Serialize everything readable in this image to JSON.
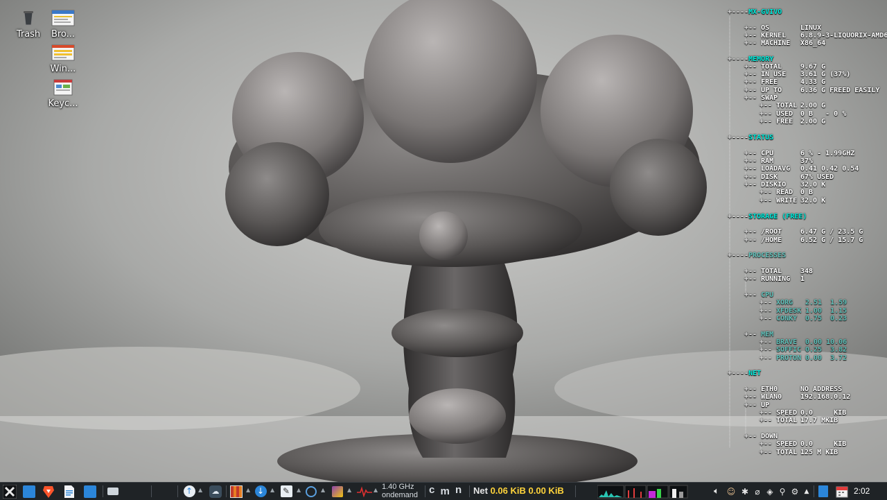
{
  "desktop": {
    "icons": [
      {
        "label": "Trash",
        "icon": "trash-icon"
      },
      {
        "label": "Bro...",
        "icon": "document-thumbnail-icon"
      },
      {
        "label": "Win...",
        "icon": "document-thumbnail-icon"
      },
      {
        "label": "Keyc...",
        "icon": "document-thumbnail-icon"
      }
    ]
  },
  "conky": {
    "host": "MX-GVIVO",
    "system": {
      "os_label": "OS",
      "os": "LINUX",
      "kernel_label": "KERNEL",
      "kernel": "6.8.9-3-LIQUORIX-AMD6",
      "machine_label": "MACHINE",
      "machine": "X86_64"
    },
    "memory": {
      "title": "MEMORY",
      "total_label": "TOTAL",
      "total": "9.67 G",
      "inuse_label": "IN USE",
      "inuse": "3.61 G (37%)",
      "free_label": "FREE",
      "free": "4.33 G",
      "upto_label": "UP TO",
      "upto": "6.36 G FREED EASILY",
      "swap_label": "SWAP",
      "swap_total_label": "TOTAL",
      "swap_total": "2.00 G",
      "swap_used_label": "USED",
      "swap_used": "0 B   - 0 %",
      "swap_free_label": "FREE",
      "swap_free": "2.00 G"
    },
    "status": {
      "title": "STATUS",
      "cpu_label": "CPU",
      "cpu": "6 % - 1.99GHZ",
      "ram_label": "RAM",
      "ram": "37%",
      "loadavg_label": "LOADAVG",
      "loadavg": "0.41 0.42 0.54",
      "disk_label": "DISK",
      "disk": "67% USED",
      "diskio_label": "DISKIO",
      "diskio": "32.0 K",
      "read_label": "READ",
      "read": "0 B",
      "write_label": "WRITE",
      "write": "32.0 K"
    },
    "storage": {
      "title": "STORAGE (FREE)",
      "root_label": "/ROOT",
      "root": "6.47 G / 23.5 G",
      "home_label": "/HOME",
      "home": "6.52 G / 15.7 G"
    },
    "processes": {
      "title": "PROCESSES",
      "total_label": "TOTAL",
      "total": "348",
      "running_label": "RUNNING",
      "running": "1",
      "cpu_label": "CPU",
      "cpu_rows": [
        {
          "name": "XORG",
          "vals": "2.51  1.59"
        },
        {
          "name": "XFDESK",
          "vals": "1.00  1.15"
        },
        {
          "name": "CONKY",
          "vals": "0.75  0.23"
        }
      ],
      "mem_label": "MEM",
      "mem_rows": [
        {
          "name": "BRAVE",
          "vals": "0.00 10.06"
        },
        {
          "name": "SOFFIC",
          "vals": "0.25  3.82"
        },
        {
          "name": "PROTON",
          "vals": "0.00  3.72"
        }
      ]
    },
    "net": {
      "title": "NET",
      "eth0_label": "ETH0",
      "eth0": "NO ADDRESS",
      "wlan0_label": "WLAN0",
      "wlan0": "192.168.0.12",
      "up_label": "UP",
      "up_speed_label": "SPEED",
      "up_speed": "0.0     KIB",
      "up_total_label": "TOTAL",
      "up_total": "17.7 MKIB",
      "down_label": "DOWN",
      "down_speed_label": "SPEED",
      "down_speed": "0.0     KIB",
      "down_total_label": "TOTAL",
      "down_total": "125 M KIB"
    }
  },
  "taskbar": {
    "cpufreq_line1": "1.40 GHz",
    "cpufreq_line2": "ondemand",
    "mon_c": "c",
    "mon_m": "m",
    "mon_n": "n",
    "net_label": "Net",
    "net_down": "0.06 KiB",
    "net_up": "0.00 KiB",
    "clock": "2:02",
    "colors": {
      "bg": "#1f2326",
      "net_down": "#ffd43b",
      "net_up": "#ffd43b",
      "accent_blue": "#2b86da"
    }
  }
}
